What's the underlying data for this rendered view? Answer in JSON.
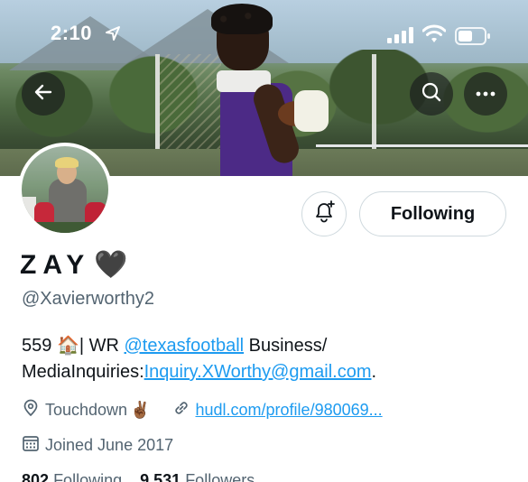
{
  "status_bar": {
    "time": "2:10",
    "icons": [
      "location-arrow-icon",
      "cellular-signal-icon",
      "wifi-icon",
      "battery-icon"
    ]
  },
  "header": {
    "back_icon": "arrow-left-icon",
    "search_icon": "search-icon",
    "more_icon": "more-horizontal-icon"
  },
  "actions": {
    "notify_icon": "bell-plus-icon",
    "follow_label": "Following"
  },
  "profile": {
    "display_name": "ZAY",
    "name_emoji": "🖤",
    "handle": "@Xavierworthy2",
    "bio": {
      "prefix": "559 ",
      "house_emoji": "🏠",
      "wr": "| WR ",
      "mention": "@texasfootball",
      "mid": " Business/ MediaInquiries:",
      "email": "Inquiry.XWorthy@gmail.com",
      "suffix": "."
    },
    "location": "Touchdown",
    "location_emoji": "✌🏾",
    "website": "hudl.com/profile/980069...",
    "joined": "Joined June 2017",
    "following_count": "802",
    "following_label": "Following",
    "followers_count": "9,531",
    "followers_label": "Followers"
  },
  "colors": {
    "accent": "#1d9bf0",
    "secondary_text": "#536471",
    "primary_text": "#0f1419",
    "border": "#cfd9de"
  }
}
